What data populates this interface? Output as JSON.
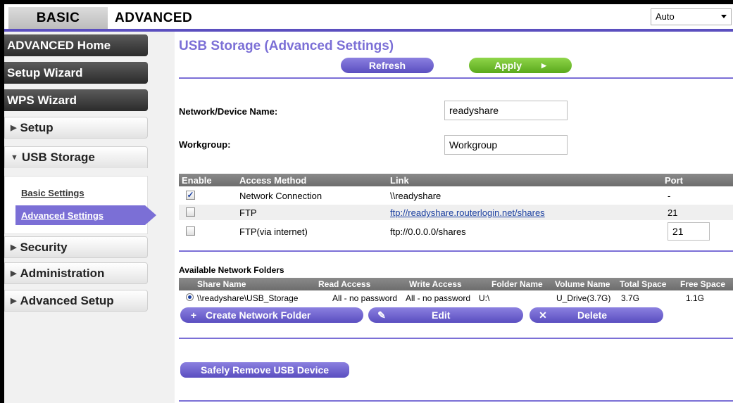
{
  "tabs": {
    "basic": "BASIC",
    "advanced": "ADVANCED"
  },
  "language": {
    "selected": "Auto"
  },
  "sidebar": {
    "advanced_home": "ADVANCED Home",
    "setup_wizard": "Setup Wizard",
    "wps_wizard": "WPS Wizard",
    "setup": "Setup",
    "usb_storage": "USB Storage",
    "basic_settings": "Basic Settings",
    "advanced_settings": "Advanced Settings",
    "security": "Security",
    "administration": "Administration",
    "advanced_setup": "Advanced Setup"
  },
  "page": {
    "title": "USB Storage (Advanced Settings)",
    "refresh": "Refresh",
    "apply": "Apply"
  },
  "form": {
    "device_name_label": "Network/Device Name:",
    "device_name_value": "readyshare",
    "workgroup_label": "Workgroup:",
    "workgroup_value": "Workgroup"
  },
  "access_table": {
    "headers": {
      "enable": "Enable",
      "method": "Access Method",
      "link": "Link",
      "port": "Port"
    },
    "rows": [
      {
        "enabled": true,
        "method": "Network Connection",
        "link": "\\\\readyshare",
        "port": "-"
      },
      {
        "enabled": false,
        "method": "FTP",
        "link": "ftp://readyshare.routerlogin.net/shares",
        "port": "21"
      },
      {
        "enabled": false,
        "method": "FTP(via internet)",
        "link": "ftp://0.0.0.0/shares",
        "port": "21"
      }
    ]
  },
  "folders": {
    "label": "Available Network Folders",
    "headers": {
      "share_name": "Share Name",
      "read_access": "Read Access",
      "write_access": "Write Access",
      "folder_name": "Folder Name",
      "volume_name": "Volume Name",
      "total_space": "Total Space",
      "free_space": "Free Space"
    },
    "rows": [
      {
        "share_name": "\\\\readyshare\\USB_Storage",
        "read_access": "All - no password",
        "write_access": "All - no password",
        "folder_name": "U:\\",
        "volume_name": "U_Drive(3.7G)",
        "total_space": "3.7G",
        "free_space": "1.1G"
      }
    ],
    "create": "Create Network Folder",
    "edit": "Edit",
    "delete": "Delete"
  },
  "safely_remove": "Safely Remove USB Device",
  "colors": {
    "accent": "#7b6fd6",
    "apply_green": "#6cbf2a"
  }
}
